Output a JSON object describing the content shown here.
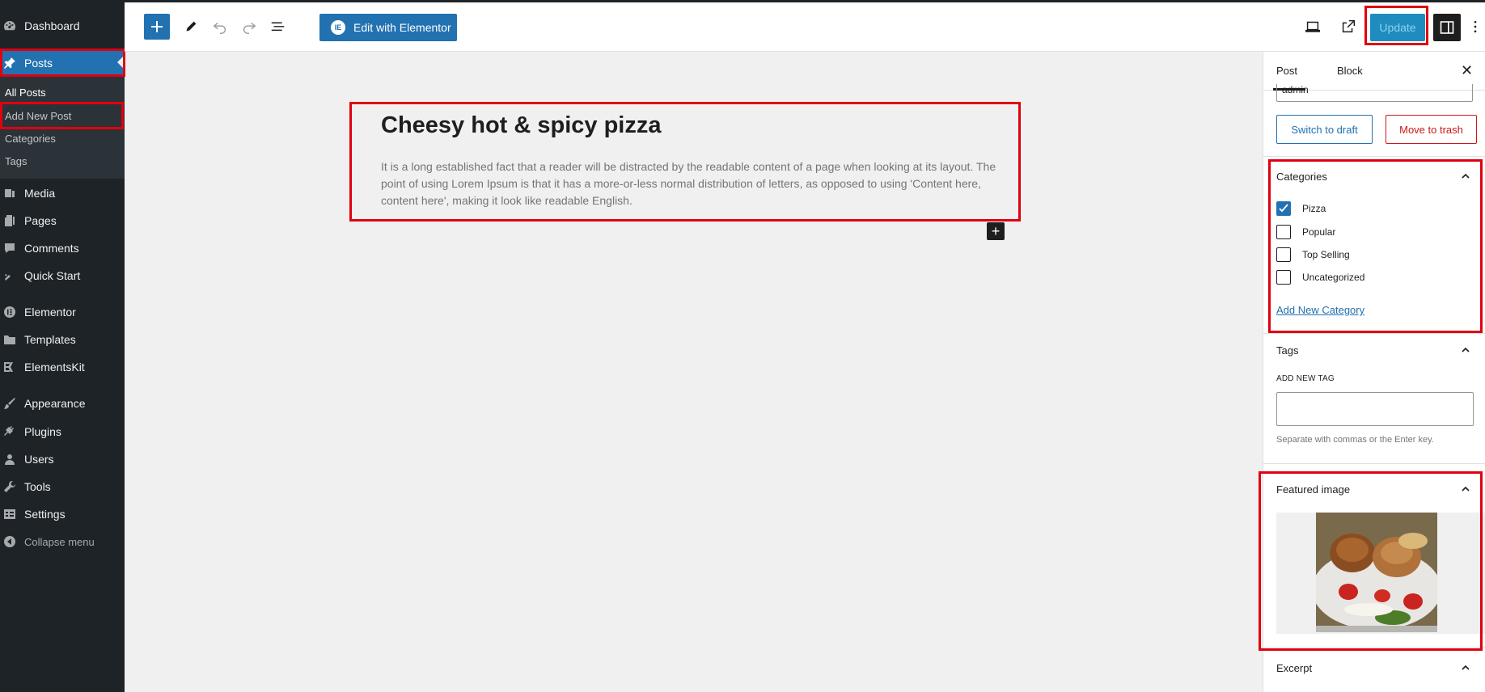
{
  "sidebar": {
    "items": [
      {
        "label": "Dashboard",
        "icon": "dashboard-icon"
      },
      {
        "label": "Posts",
        "icon": "pin-icon"
      },
      {
        "label": "Media",
        "icon": "media-icon"
      },
      {
        "label": "Pages",
        "icon": "pages-icon"
      },
      {
        "label": "Comments",
        "icon": "comments-icon"
      },
      {
        "label": "Quick Start",
        "icon": "quick-start-icon"
      },
      {
        "label": "Elementor",
        "icon": "elementor-icon"
      },
      {
        "label": "Templates",
        "icon": "folder-icon"
      },
      {
        "label": "ElementsKit",
        "icon": "elementskit-icon"
      },
      {
        "label": "Appearance",
        "icon": "brush-icon"
      },
      {
        "label": "Plugins",
        "icon": "plugin-icon"
      },
      {
        "label": "Users",
        "icon": "users-icon"
      },
      {
        "label": "Tools",
        "icon": "wrench-icon"
      },
      {
        "label": "Settings",
        "icon": "settings-icon"
      },
      {
        "label": "Collapse menu",
        "icon": "collapse-icon"
      }
    ],
    "posts_submenu": [
      "All Posts",
      "Add New Post",
      "Categories",
      "Tags"
    ]
  },
  "toolbar": {
    "edit_with_elementor": "Edit with Elementor",
    "update": "Update"
  },
  "post": {
    "title": "Cheesy hot & spicy pizza",
    "body": "It is a long established fact that a reader will be distracted by the readable content of a page when looking at its layout. The point of using Lorem Ipsum is that it has a more-or-less normal distribution of letters, as opposed to using 'Content here, content here', making it look like readable English."
  },
  "panel": {
    "tabs": [
      "Post",
      "Block"
    ],
    "author_value": "admin",
    "switch_to_draft": "Switch to draft",
    "move_to_trash": "Move to trash",
    "categories_title": "Categories",
    "categories": [
      {
        "label": "Pizza",
        "checked": true
      },
      {
        "label": "Popular",
        "checked": false
      },
      {
        "label": "Top Selling",
        "checked": false
      },
      {
        "label": "Uncategorized",
        "checked": false
      }
    ],
    "add_new_category": "Add New Category",
    "tags_title": "Tags",
    "add_new_tag_label": "ADD NEW TAG",
    "tags_help": "Separate with commas or the Enter key.",
    "featured_image_title": "Featured image",
    "excerpt_title": "Excerpt"
  },
  "colors": {
    "sidebar_bg": "#1d2327",
    "accent": "#2271b1",
    "highlight": "#e0000f",
    "trash": "#cc1818"
  }
}
